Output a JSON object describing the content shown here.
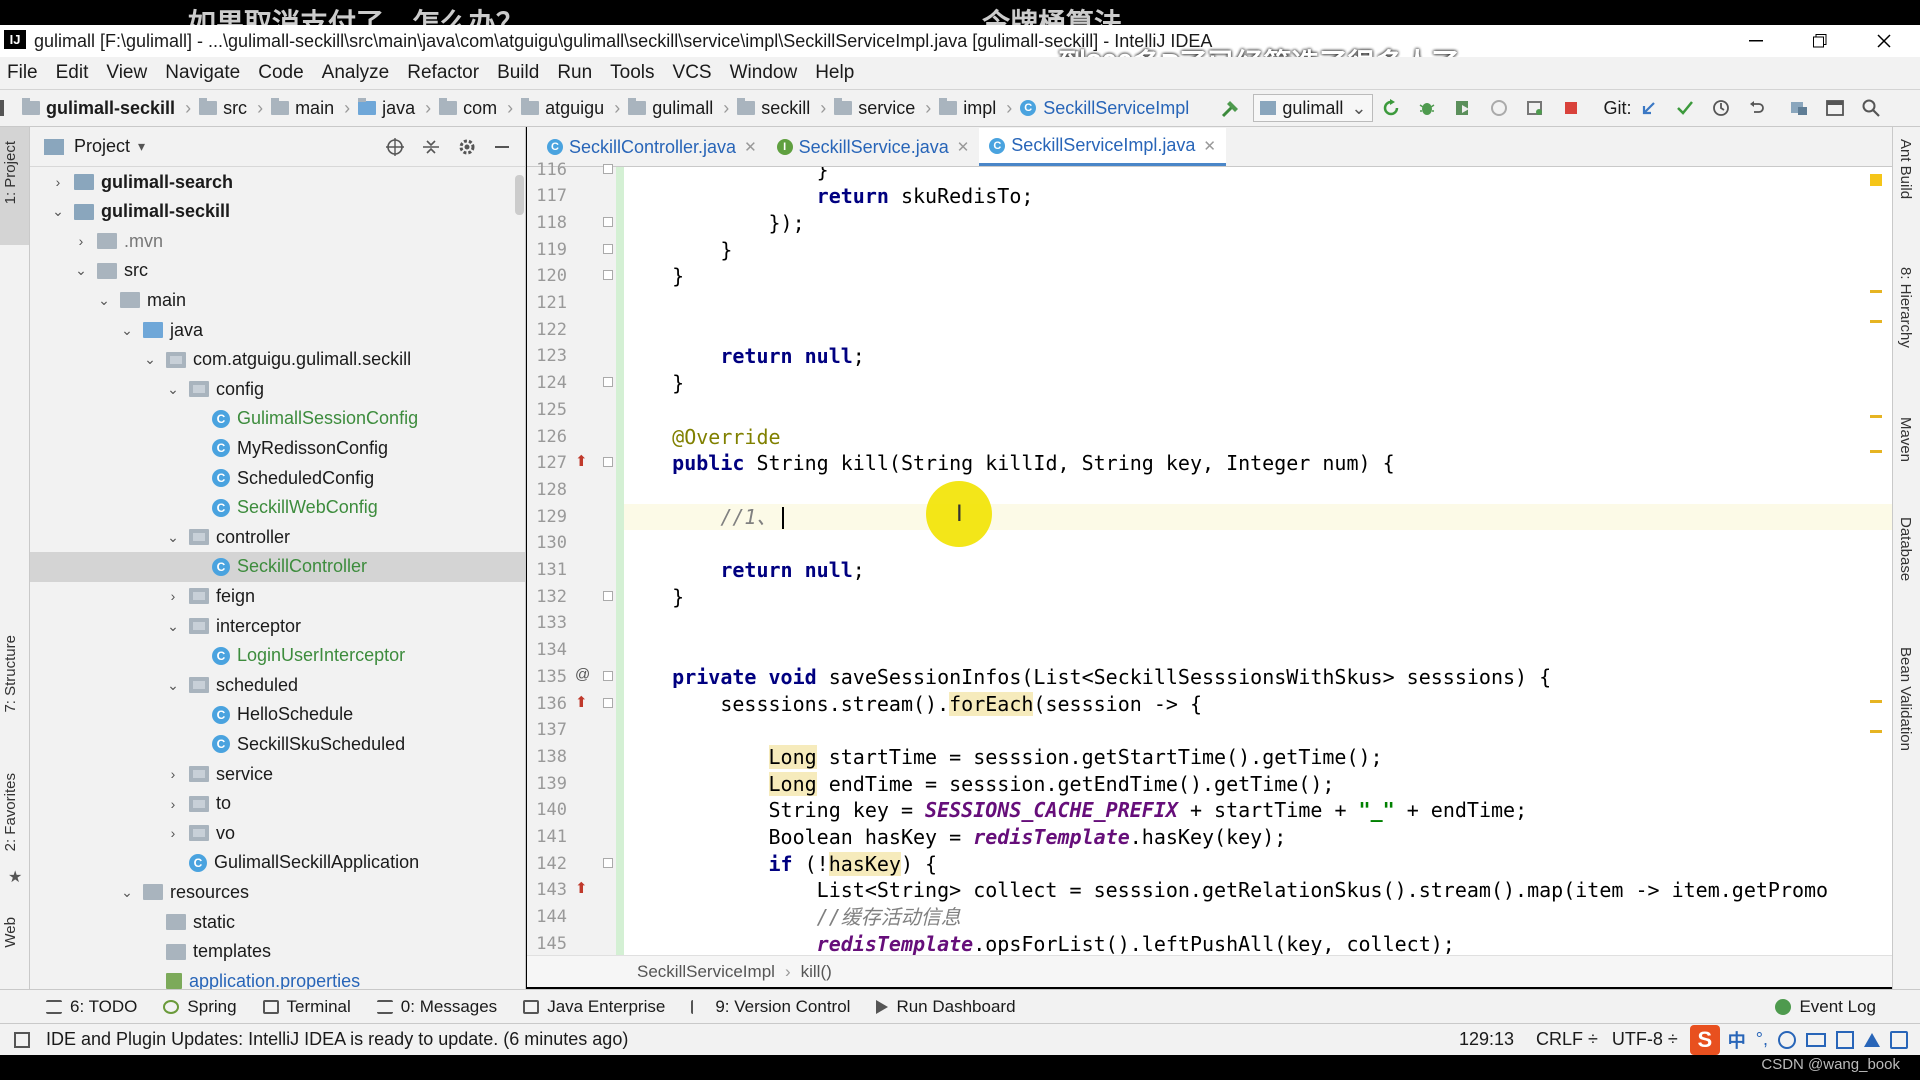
{
  "overlay": {
    "caption_left": "如果取消支付了，怎么办？",
    "caption_right": "令牌桶算法",
    "caption_bottom": "到300多P了已经筛选了很多人了",
    "watermark": "CSDN @wang_book"
  },
  "window": {
    "title": "gulimall [F:\\gulimall] - ...\\gulimall-seckill\\src\\main\\java\\com\\atguigu\\gulimall\\seckill\\service\\impl\\SeckillServiceImpl.java [gulimall-seckill] - IntelliJ IDEA"
  },
  "menu": [
    "File",
    "Edit",
    "View",
    "Navigate",
    "Code",
    "Analyze",
    "Refactor",
    "Build",
    "Run",
    "Tools",
    "VCS",
    "Window",
    "Help"
  ],
  "breadcrumbs": [
    "gulimall-seckill",
    "src",
    "main",
    "java",
    "com",
    "atguigu",
    "gulimall",
    "seckill",
    "service",
    "impl",
    "SeckillServiceImpl"
  ],
  "toolbar": {
    "run_config": "gulimall",
    "git_label": "Git:"
  },
  "left_stripe": {
    "project": "1: Project",
    "structure": "7: Structure",
    "favorites": "2: Favorites",
    "web": "Web"
  },
  "right_stripe": {
    "ant": "Ant Build",
    "hierarchy": "8: Hierarchy",
    "maven": "Maven",
    "database": "Database",
    "bean": "Bean Validation"
  },
  "project_panel": {
    "header": "Project",
    "tree": [
      {
        "label": "gulimall-search",
        "indent": 0,
        "arrow": "›",
        "icon": "module",
        "style": "bold"
      },
      {
        "label": "gulimall-seckill",
        "indent": 0,
        "arrow": "⌄",
        "icon": "module",
        "style": "bold"
      },
      {
        "label": ".mvn",
        "indent": 1,
        "arrow": "›",
        "icon": "folder",
        "style": "muted"
      },
      {
        "label": "src",
        "indent": 1,
        "arrow": "⌄",
        "icon": "folder",
        "style": ""
      },
      {
        "label": "main",
        "indent": 2,
        "arrow": "⌄",
        "icon": "folder",
        "style": ""
      },
      {
        "label": "java",
        "indent": 3,
        "arrow": "⌄",
        "icon": "src",
        "style": ""
      },
      {
        "label": "com.atguigu.gulimall.seckill",
        "indent": 4,
        "arrow": "⌄",
        "icon": "pkg",
        "style": ""
      },
      {
        "label": "config",
        "indent": 5,
        "arrow": "⌄",
        "icon": "pkg",
        "style": ""
      },
      {
        "label": "GulimallSessionConfig",
        "indent": 6,
        "arrow": "",
        "icon": "class",
        "style": "green"
      },
      {
        "label": "MyRedissonConfig",
        "indent": 6,
        "arrow": "",
        "icon": "class",
        "style": ""
      },
      {
        "label": "ScheduledConfig",
        "indent": 6,
        "arrow": "",
        "icon": "class",
        "style": ""
      },
      {
        "label": "SeckillWebConfig",
        "indent": 6,
        "arrow": "",
        "icon": "class",
        "style": "green"
      },
      {
        "label": "controller",
        "indent": 5,
        "arrow": "⌄",
        "icon": "pkg",
        "style": ""
      },
      {
        "label": "SeckillController",
        "indent": 6,
        "arrow": "",
        "icon": "class",
        "style": "green",
        "selected": true
      },
      {
        "label": "feign",
        "indent": 5,
        "arrow": "›",
        "icon": "pkg",
        "style": ""
      },
      {
        "label": "interceptor",
        "indent": 5,
        "arrow": "⌄",
        "icon": "pkg",
        "style": ""
      },
      {
        "label": "LoginUserInterceptor",
        "indent": 6,
        "arrow": "",
        "icon": "class",
        "style": "green"
      },
      {
        "label": "scheduled",
        "indent": 5,
        "arrow": "⌄",
        "icon": "pkg",
        "style": ""
      },
      {
        "label": "HelloSchedule",
        "indent": 6,
        "arrow": "",
        "icon": "class",
        "style": ""
      },
      {
        "label": "SeckillSkuScheduled",
        "indent": 6,
        "arrow": "",
        "icon": "class",
        "style": ""
      },
      {
        "label": "service",
        "indent": 5,
        "arrow": "›",
        "icon": "pkg",
        "style": ""
      },
      {
        "label": "to",
        "indent": 5,
        "arrow": "›",
        "icon": "pkg",
        "style": ""
      },
      {
        "label": "vo",
        "indent": 5,
        "arrow": "›",
        "icon": "pkg",
        "style": ""
      },
      {
        "label": "GulimallSeckillApplication",
        "indent": 5,
        "arrow": "",
        "icon": "app",
        "style": ""
      },
      {
        "label": "resources",
        "indent": 3,
        "arrow": "⌄",
        "icon": "res",
        "style": ""
      },
      {
        "label": "static",
        "indent": 4,
        "arrow": "",
        "icon": "folder",
        "style": ""
      },
      {
        "label": "templates",
        "indent": 4,
        "arrow": "",
        "icon": "folder",
        "style": ""
      },
      {
        "label": "application.properties",
        "indent": 4,
        "arrow": "",
        "icon": "props",
        "style": "blue"
      }
    ]
  },
  "editor": {
    "tabs": [
      {
        "label": "SeckillController.java",
        "kind": "C",
        "active": false
      },
      {
        "label": "SeckillService.java",
        "kind": "I",
        "active": false
      },
      {
        "label": "SeckillServiceImpl.java",
        "kind": "C",
        "active": true
      }
    ],
    "line_numbers": [
      "116",
      "117",
      "118",
      "119",
      "120",
      "121",
      "122",
      "123",
      "124",
      "125",
      "126",
      "127",
      "128",
      "129",
      "130",
      "131",
      "132",
      "133",
      "134",
      "135",
      "136",
      "137",
      "138",
      "139",
      "140",
      "141",
      "142",
      "143",
      "144",
      "145"
    ],
    "current_line_index": 13,
    "code_lines": [
      "                }",
      "                <k>return</k> skuRedisTo;",
      "            });",
      "        }",
      "    }",
      "",
      "",
      "        <k>return null</k>;",
      "    }",
      "",
      "    <an>@Override</an>",
      "    <k>public</k> String kill(String killId, String key, Integer num) {",
      "",
      "        <cm>//1、</cm>",
      "",
      "        <k>return null</k>;",
      "    }",
      "",
      "",
      "    <k>private void</k> saveSessionInfos(List&lt;SeckillSesssionsWithSkus&gt; sesssions) {",
      "        sesssions.stream().<hl>forEach</hl>(sesssion -> {",
      "",
      "            <hl>Long</hl> startTime = sesssion.getStartTime().getTime();",
      "            <hl>Long</hl> endTime = sesssion.getEndTime().getTime();",
      "            String key = <cn>SESSIONS_CACHE_PREFIX</cn> + startTime + <st>\"_\"</st> + endTime;",
      "            Boolean hasKey = <b>redisTemplate</b>.hasKey(key);",
      "            <k>if</k> (!<hl>hasKey</hl>) {",
      "                List&lt;String&gt; collect = sesssion.getRelationSkus().stream().map(item -> item.getPromo",
      "                <cm>//缓存活动信息</cm>",
      "                <b>redisTemplate</b>.opsForList().leftPushAll(key, collect);"
    ],
    "crumb": [
      "SeckillServiceImpl",
      "kill()"
    ]
  },
  "tool_windows": [
    "6: TODO",
    "Spring",
    "Terminal",
    "0: Messages",
    "Java Enterprise",
    "9: Version Control",
    "Run Dashboard"
  ],
  "event_log": "Event Log",
  "status": {
    "message": "IDE and Plugin Updates: IntelliJ IDEA is ready to update. (6 minutes ago)",
    "position": "129:13",
    "line_sep": "CRLF",
    "encoding": "UTF-8",
    "ime": "中"
  }
}
